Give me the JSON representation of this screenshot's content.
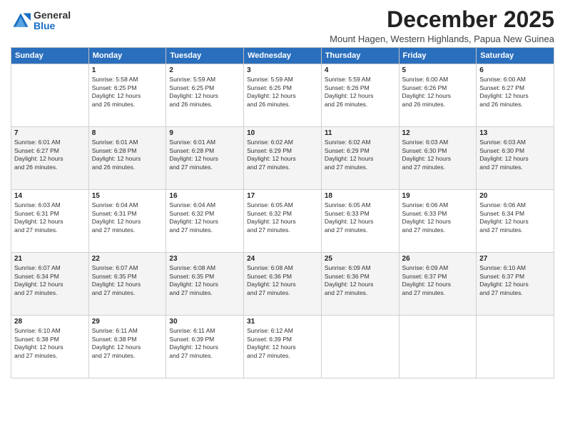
{
  "logo": {
    "general": "General",
    "blue": "Blue"
  },
  "title": "December 2025",
  "location": "Mount Hagen, Western Highlands, Papua New Guinea",
  "days": [
    "Sunday",
    "Monday",
    "Tuesday",
    "Wednesday",
    "Thursday",
    "Friday",
    "Saturday"
  ],
  "weeks": [
    [
      {
        "date": "",
        "info": ""
      },
      {
        "date": "1",
        "info": "Sunrise: 5:58 AM\nSunset: 6:25 PM\nDaylight: 12 hours\nand 26 minutes."
      },
      {
        "date": "2",
        "info": "Sunrise: 5:59 AM\nSunset: 6:25 PM\nDaylight: 12 hours\nand 26 minutes."
      },
      {
        "date": "3",
        "info": "Sunrise: 5:59 AM\nSunset: 6:25 PM\nDaylight: 12 hours\nand 26 minutes."
      },
      {
        "date": "4",
        "info": "Sunrise: 5:59 AM\nSunset: 6:26 PM\nDaylight: 12 hours\nand 26 minutes."
      },
      {
        "date": "5",
        "info": "Sunrise: 6:00 AM\nSunset: 6:26 PM\nDaylight: 12 hours\nand 26 minutes."
      },
      {
        "date": "6",
        "info": "Sunrise: 6:00 AM\nSunset: 6:27 PM\nDaylight: 12 hours\nand 26 minutes."
      }
    ],
    [
      {
        "date": "7",
        "info": "Sunrise: 6:01 AM\nSunset: 6:27 PM\nDaylight: 12 hours\nand 26 minutes."
      },
      {
        "date": "8",
        "info": "Sunrise: 6:01 AM\nSunset: 6:28 PM\nDaylight: 12 hours\nand 26 minutes."
      },
      {
        "date": "9",
        "info": "Sunrise: 6:01 AM\nSunset: 6:28 PM\nDaylight: 12 hours\nand 27 minutes."
      },
      {
        "date": "10",
        "info": "Sunrise: 6:02 AM\nSunset: 6:29 PM\nDaylight: 12 hours\nand 27 minutes."
      },
      {
        "date": "11",
        "info": "Sunrise: 6:02 AM\nSunset: 6:29 PM\nDaylight: 12 hours\nand 27 minutes."
      },
      {
        "date": "12",
        "info": "Sunrise: 6:03 AM\nSunset: 6:30 PM\nDaylight: 12 hours\nand 27 minutes."
      },
      {
        "date": "13",
        "info": "Sunrise: 6:03 AM\nSunset: 6:30 PM\nDaylight: 12 hours\nand 27 minutes."
      }
    ],
    [
      {
        "date": "14",
        "info": "Sunrise: 6:03 AM\nSunset: 6:31 PM\nDaylight: 12 hours\nand 27 minutes."
      },
      {
        "date": "15",
        "info": "Sunrise: 6:04 AM\nSunset: 6:31 PM\nDaylight: 12 hours\nand 27 minutes."
      },
      {
        "date": "16",
        "info": "Sunrise: 6:04 AM\nSunset: 6:32 PM\nDaylight: 12 hours\nand 27 minutes."
      },
      {
        "date": "17",
        "info": "Sunrise: 6:05 AM\nSunset: 6:32 PM\nDaylight: 12 hours\nand 27 minutes."
      },
      {
        "date": "18",
        "info": "Sunrise: 6:05 AM\nSunset: 6:33 PM\nDaylight: 12 hours\nand 27 minutes."
      },
      {
        "date": "19",
        "info": "Sunrise: 6:06 AM\nSunset: 6:33 PM\nDaylight: 12 hours\nand 27 minutes."
      },
      {
        "date": "20",
        "info": "Sunrise: 6:06 AM\nSunset: 6:34 PM\nDaylight: 12 hours\nand 27 minutes."
      }
    ],
    [
      {
        "date": "21",
        "info": "Sunrise: 6:07 AM\nSunset: 6:34 PM\nDaylight: 12 hours\nand 27 minutes."
      },
      {
        "date": "22",
        "info": "Sunrise: 6:07 AM\nSunset: 6:35 PM\nDaylight: 12 hours\nand 27 minutes."
      },
      {
        "date": "23",
        "info": "Sunrise: 6:08 AM\nSunset: 6:35 PM\nDaylight: 12 hours\nand 27 minutes."
      },
      {
        "date": "24",
        "info": "Sunrise: 6:08 AM\nSunset: 6:36 PM\nDaylight: 12 hours\nand 27 minutes."
      },
      {
        "date": "25",
        "info": "Sunrise: 6:09 AM\nSunset: 6:36 PM\nDaylight: 12 hours\nand 27 minutes."
      },
      {
        "date": "26",
        "info": "Sunrise: 6:09 AM\nSunset: 6:37 PM\nDaylight: 12 hours\nand 27 minutes."
      },
      {
        "date": "27",
        "info": "Sunrise: 6:10 AM\nSunset: 6:37 PM\nDaylight: 12 hours\nand 27 minutes."
      }
    ],
    [
      {
        "date": "28",
        "info": "Sunrise: 6:10 AM\nSunset: 6:38 PM\nDaylight: 12 hours\nand 27 minutes."
      },
      {
        "date": "29",
        "info": "Sunrise: 6:11 AM\nSunset: 6:38 PM\nDaylight: 12 hours\nand 27 minutes."
      },
      {
        "date": "30",
        "info": "Sunrise: 6:11 AM\nSunset: 6:39 PM\nDaylight: 12 hours\nand 27 minutes."
      },
      {
        "date": "31",
        "info": "Sunrise: 6:12 AM\nSunset: 6:39 PM\nDaylight: 12 hours\nand 27 minutes."
      },
      {
        "date": "",
        "info": ""
      },
      {
        "date": "",
        "info": ""
      },
      {
        "date": "",
        "info": ""
      }
    ]
  ]
}
